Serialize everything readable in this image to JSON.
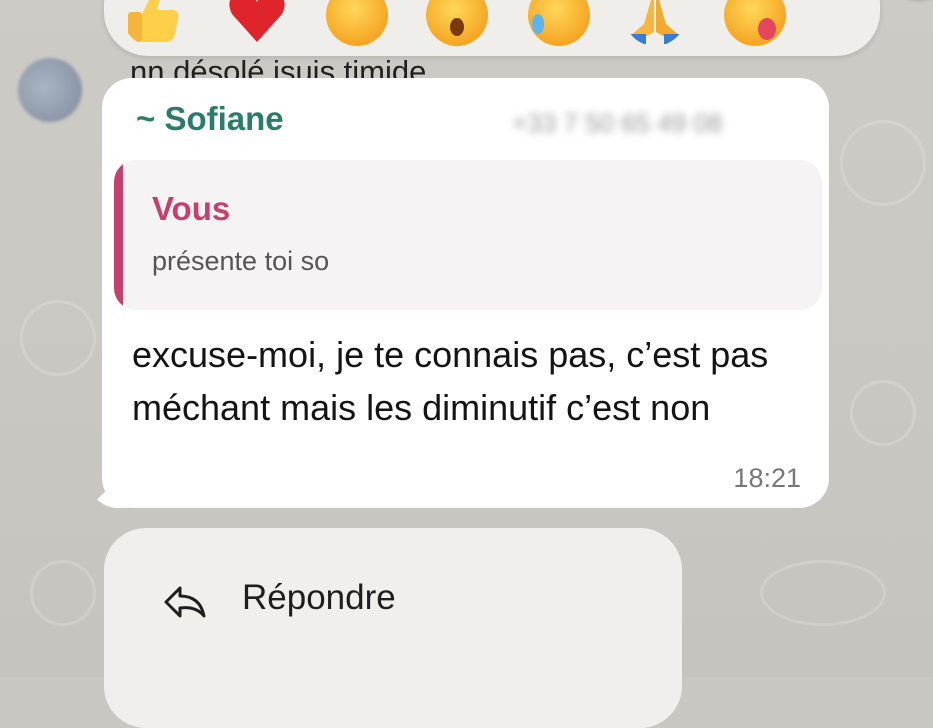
{
  "reactions": [
    "thumbs-up",
    "heart",
    "laughing",
    "surprised",
    "sad",
    "praying",
    "tongue"
  ],
  "previous_message": {
    "text": "nn désolé jsuis timide"
  },
  "message": {
    "sender_name": "~ Sofiane",
    "sender_phone": "+33 7 50 65 49 08",
    "reply": {
      "author": "Vous",
      "text": "présente toi so"
    },
    "text": "excuse-moi, je te connais pas, c’est pas méchant mais les diminutif c’est non",
    "time": "18:21"
  },
  "context_menu": {
    "items": [
      {
        "label": "Répondre",
        "icon": "reply-icon"
      }
    ]
  },
  "colors": {
    "sender": "#2a7c6b",
    "quote_accent": "#c6406e",
    "bubble": "#ffffff"
  }
}
